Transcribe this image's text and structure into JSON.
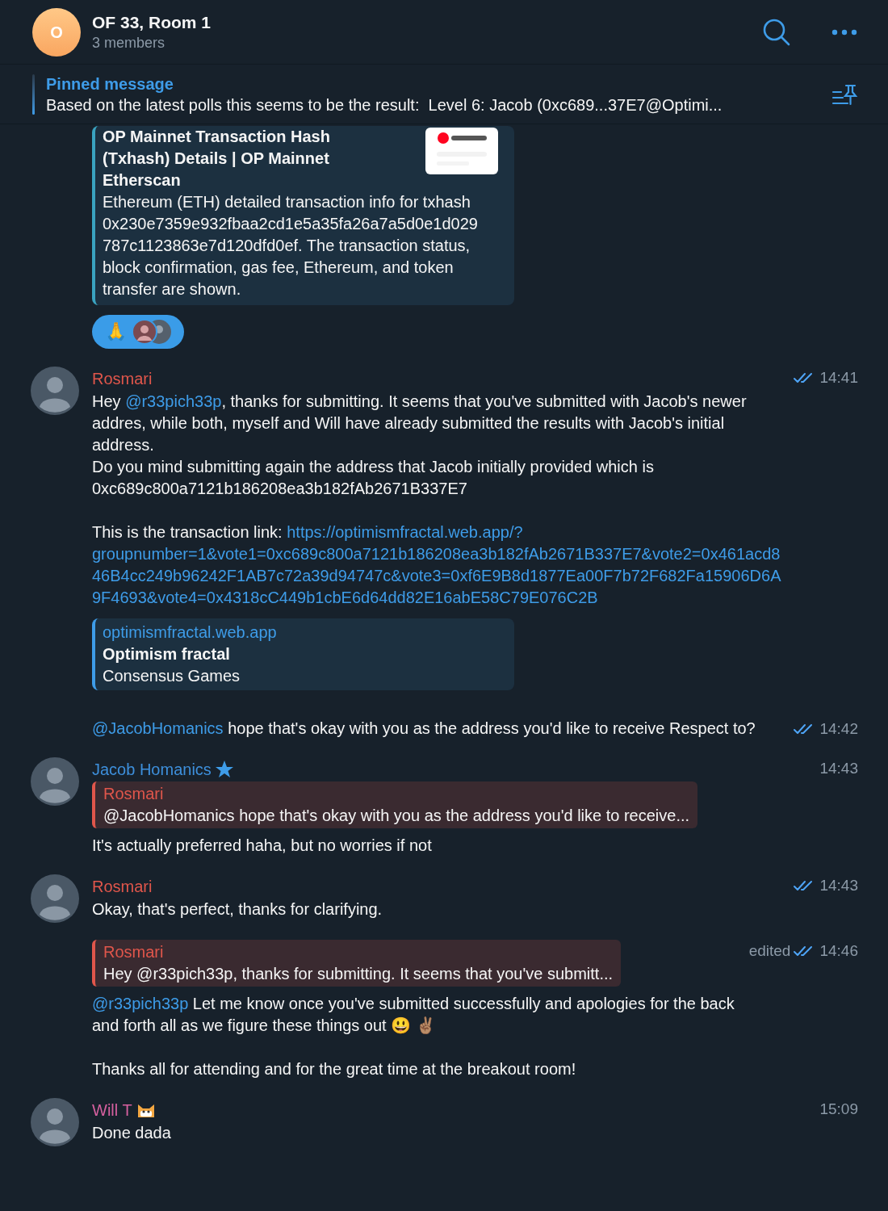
{
  "header": {
    "avatar_letter": "O",
    "title": "OF 33, Room 1",
    "subtitle": "3 members"
  },
  "pinned": {
    "label": "Pinned message",
    "text": "Based on the latest polls this seems to be the result:  Level 6: Jacob (0xc689...37E7@Optimi..."
  },
  "feed": [
    {
      "kind": "preview_tail",
      "title": "OP Mainnet Transaction Hash (Txhash) Details | OP Mainnet Etherscan",
      "description": "Ethereum (ETH) detailed transaction info for txhash 0x230e7359e932fbaa2cd1e5a35fa26a7a5d0e1d029787c1123863e7d120dfd0ef. The transaction status, block confirmation, gas fee, Ethereum, and token transfer are shown.",
      "reaction": {
        "emoji": "🙏",
        "selected": true
      }
    },
    {
      "kind": "group",
      "sender": "Rosmari",
      "color": "#e0564b",
      "messages": [
        {
          "time": "14:41",
          "read": true,
          "paragraphs": [
            [
              {
                "kind": "plain",
                "text": "Hey "
              },
              {
                "kind": "mention",
                "text": "@r33pich33p"
              },
              {
                "kind": "plain",
                "text": ", thanks for submitting. It seems that you've submitted with Jacob's newer addres, while both, myself and Will have already submitted the results with Jacob's initial address.\nDo you mind submitting again the address that Jacob initially provided which is 0xc689c800a7121b186208ea3b182fAb2671B337E7"
              }
            ],
            [
              {
                "kind": "plain",
                "text": "This is the transaction link: "
              },
              {
                "kind": "link",
                "text": "https://optimismfractal.web.app/?"
              },
              {
                "kind": "link_block",
                "text": "groupnumber=1&vote1=0xc689c800a7121b186208ea3b182fAb2671B337E7&vote2=0x461acd846B4cc249b96242F1AB7c72a39d94747c&vote3=0xf6E9B8d1877Ea00F7b72F682Fa15906D6A9F4693&vote4=0x4318cC449b1cbE6d64dd82E16abE58C79E076C2B"
              }
            ]
          ],
          "preview": {
            "site": "optimismfractal.web.app",
            "title": "Optimism fractal",
            "description": "Consensus Games"
          }
        },
        {
          "time": "14:42",
          "read": true,
          "paragraphs": [
            [
              {
                "kind": "mention",
                "text": "@JacobHomanics"
              },
              {
                "kind": "plain",
                "text": " hope that's okay with you as the address you'd like to receive Respect to?"
              }
            ]
          ]
        }
      ]
    },
    {
      "kind": "group",
      "sender": "Jacob Homanics",
      "color": "#3d8fdb",
      "badge": {
        "kind": "star"
      },
      "messages": [
        {
          "time": "14:43",
          "read": false,
          "reply": {
            "sender": "Rosmari",
            "text": "@JacobHomanics hope that's okay with you as the address you'd like to receive..."
          },
          "paragraphs": [
            [
              {
                "kind": "plain",
                "text": "It's actually preferred haha, but no worries if not"
              }
            ]
          ]
        }
      ]
    },
    {
      "kind": "group",
      "sender": "Rosmari",
      "color": "#e0564b",
      "messages": [
        {
          "time": "14:43",
          "read": true,
          "paragraphs": [
            [
              {
                "kind": "plain",
                "text": "Okay, that's perfect, thanks for clarifying."
              }
            ]
          ]
        },
        {
          "time": "14:46",
          "read": true,
          "edited": "edited",
          "reply": {
            "sender": "Rosmari",
            "text": "Hey @r33pich33p, thanks for submitting. It seems that you've submitt..."
          },
          "paragraphs": [
            [
              {
                "kind": "mention",
                "text": "@r33pich33p"
              },
              {
                "kind": "plain",
                "text": " Let me know once you've submitted successfully and apologies for the back and forth all as we figure these things out 😃 ✌🏽"
              }
            ],
            [
              {
                "kind": "plain",
                "text": "Thanks all for attending and for the great time at the breakout room!"
              }
            ]
          ]
        }
      ]
    },
    {
      "kind": "group",
      "sender": "Will T",
      "color": "#d5609f",
      "badge": {
        "kind": "cat"
      },
      "messages": [
        {
          "time": "15:09",
          "read": false,
          "paragraphs": [
            [
              {
                "kind": "plain",
                "text": "Done dada"
              }
            ]
          ]
        }
      ]
    }
  ]
}
